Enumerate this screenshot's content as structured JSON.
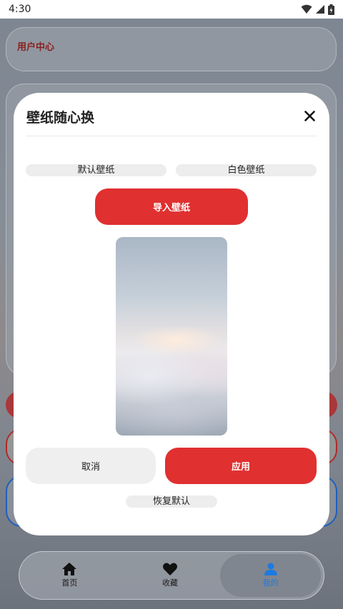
{
  "status_bar": {
    "time": "4:30",
    "icons": [
      "wifi-icon",
      "signal-icon",
      "battery-icon"
    ]
  },
  "background": {
    "header_title": "用户中心"
  },
  "modal": {
    "title": "壁纸随心换",
    "close_icon": "close-icon",
    "default_wallpaper_label": "默认壁纸",
    "white_wallpaper_label": "白色壁纸",
    "import_label": "导入壁纸",
    "cancel_label": "取消",
    "apply_label": "应用",
    "reset_label": "恢复默认"
  },
  "bottom_nav": {
    "items": [
      {
        "label": "首页",
        "icon": "home-icon"
      },
      {
        "label": "收藏",
        "icon": "heart-icon"
      },
      {
        "label": "我的",
        "icon": "user-icon",
        "active": true
      }
    ]
  },
  "colors": {
    "accent_red": "#e03030",
    "active_blue": "#1e7ae0"
  }
}
